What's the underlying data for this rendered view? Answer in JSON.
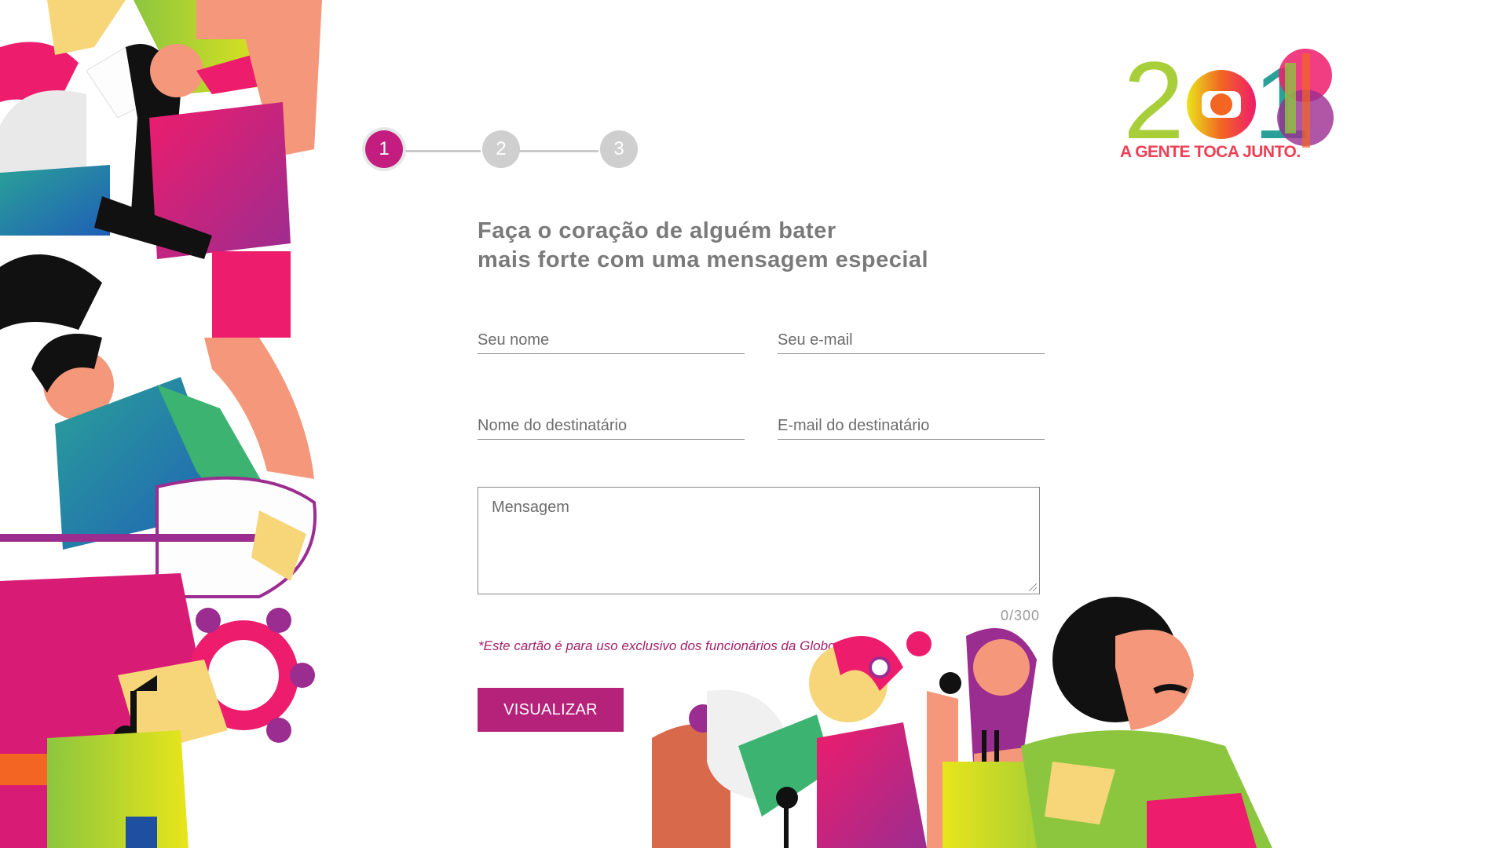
{
  "logo": {
    "year_digits": [
      "2",
      "1",
      "8"
    ],
    "tagline": "A GENTE TOCA JUNTO."
  },
  "steps": [
    {
      "label": "1",
      "active": true
    },
    {
      "label": "2",
      "active": false
    },
    {
      "label": "3",
      "active": false
    }
  ],
  "headline": {
    "line1": "Faça o coração de alguém bater",
    "line2": "mais forte com uma mensagem especial"
  },
  "form": {
    "sender_name_placeholder": "Seu nome",
    "sender_email_placeholder": "Seu e-mail",
    "recipient_name_placeholder": "Nome do destinatário",
    "recipient_email_placeholder": "E-mail do destinatário",
    "message_placeholder": "Mensagem",
    "counter": "0/300"
  },
  "disclaimer": "*Este cartão é para uso exclusivo dos funcionários da Globo.",
  "button_label": "VISUALIZAR",
  "colors": {
    "magenta": "#c31d7f",
    "button": "#b5227a",
    "pink": "#ee1c6c",
    "salmon": "#f4977a",
    "green": "#8cc63f",
    "teal": "#2aa198",
    "blue": "#1f73b7",
    "purple": "#9b2d90",
    "yellow": "#e8e51a",
    "orange": "#f26522"
  }
}
